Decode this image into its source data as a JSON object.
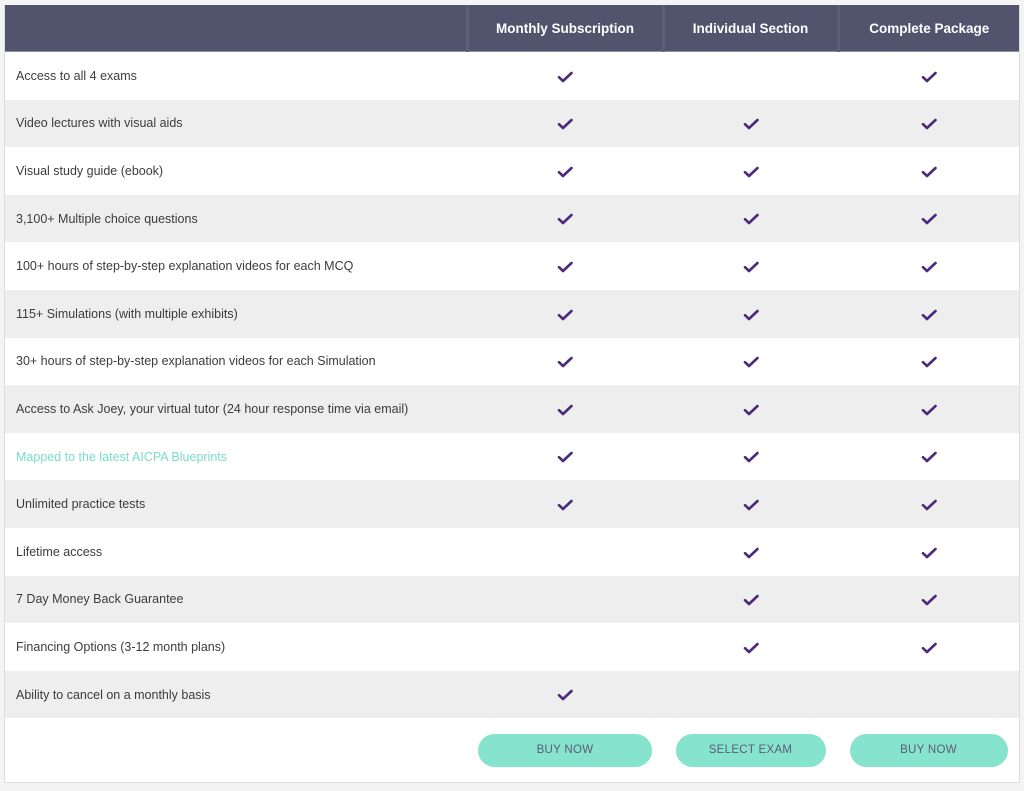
{
  "colors": {
    "header_bg": "#52546e",
    "header_text": "#ffffff",
    "check": "#4b2a7a",
    "accent": "#86e3cd",
    "highlight_text": "#79ddc7",
    "row_alt": "#eeeeee"
  },
  "header": {
    "columns": [
      "",
      "Monthly Subscription",
      "Individual Section",
      "Complete Package"
    ]
  },
  "features": [
    {
      "label": "Access to all 4 exams",
      "highlight": false,
      "monthly": true,
      "individual": false,
      "complete": true
    },
    {
      "label": "Video lectures with visual aids",
      "highlight": false,
      "monthly": true,
      "individual": true,
      "complete": true
    },
    {
      "label": "Visual study guide (ebook)",
      "highlight": false,
      "monthly": true,
      "individual": true,
      "complete": true
    },
    {
      "label": "3,100+ Multiple choice questions",
      "highlight": false,
      "monthly": true,
      "individual": true,
      "complete": true
    },
    {
      "label": "100+ hours of step-by-step explanation videos for each MCQ",
      "highlight": false,
      "monthly": true,
      "individual": true,
      "complete": true
    },
    {
      "label": "115+ Simulations (with multiple exhibits)",
      "highlight": false,
      "monthly": true,
      "individual": true,
      "complete": true
    },
    {
      "label": "30+ hours of step-by-step explanation videos for each Simulation",
      "highlight": false,
      "monthly": true,
      "individual": true,
      "complete": true
    },
    {
      "label": "Access to Ask Joey, your virtual tutor (24 hour response time via email)",
      "highlight": false,
      "monthly": true,
      "individual": true,
      "complete": true
    },
    {
      "label": "Mapped to the latest AICPA Blueprints",
      "highlight": true,
      "monthly": true,
      "individual": true,
      "complete": true
    },
    {
      "label": "Unlimited practice tests",
      "highlight": false,
      "monthly": true,
      "individual": true,
      "complete": true
    },
    {
      "label": "Lifetime access",
      "highlight": false,
      "monthly": false,
      "individual": true,
      "complete": true
    },
    {
      "label": "7 Day Money Back Guarantee",
      "highlight": false,
      "monthly": false,
      "individual": true,
      "complete": true
    },
    {
      "label": "Financing Options (3-12 month plans)",
      "highlight": false,
      "monthly": false,
      "individual": true,
      "complete": true
    },
    {
      "label": "Ability to cancel on a monthly basis",
      "highlight": false,
      "monthly": true,
      "individual": false,
      "complete": false
    }
  ],
  "buttons": {
    "monthly": "BUY NOW",
    "individual": "SELECT EXAM",
    "complete": "BUY NOW"
  },
  "icons": {
    "included": "check-icon"
  }
}
